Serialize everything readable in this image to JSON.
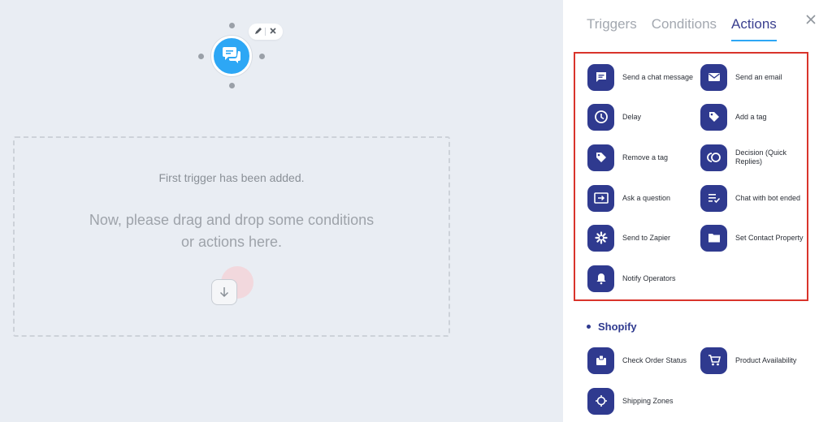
{
  "canvas": {
    "first_trigger_text": "First trigger has been added.",
    "instruction_text": "Now, please drag and drop some conditions or actions here."
  },
  "panel": {
    "tabs": [
      {
        "label": "Triggers"
      },
      {
        "label": "Conditions"
      },
      {
        "label": "Actions"
      }
    ],
    "actions": [
      {
        "label": "Send a chat message",
        "icon": "chat-message-icon"
      },
      {
        "label": "Send an email",
        "icon": "email-icon"
      },
      {
        "label": "Delay",
        "icon": "clock-icon"
      },
      {
        "label": "Add a tag",
        "icon": "tag-icon"
      },
      {
        "label": "Remove a tag",
        "icon": "tag-icon"
      },
      {
        "label": "Decision (Quick Replies)",
        "icon": "decision-icon"
      },
      {
        "label": "Ask a question",
        "icon": "ask-question-icon"
      },
      {
        "label": "Chat with bot ended",
        "icon": "chat-ended-icon"
      },
      {
        "label": "Send to Zapier",
        "icon": "zapier-icon"
      },
      {
        "label": "Set Contact Property",
        "icon": "folder-icon"
      },
      {
        "label": "Notify Operators",
        "icon": "bell-icon"
      }
    ],
    "shopify": {
      "title": "Shopify",
      "items": [
        {
          "label": "Check Order Status",
          "icon": "order-status-icon"
        },
        {
          "label": "Product Availability",
          "icon": "cart-icon"
        },
        {
          "label": "Shipping Zones",
          "icon": "shipping-icon"
        }
      ]
    }
  },
  "colors": {
    "accent": "#2f3a8f",
    "node": "#2da7f5",
    "highlight_border": "#d9342b",
    "canvas_bg": "#e9edf3"
  }
}
